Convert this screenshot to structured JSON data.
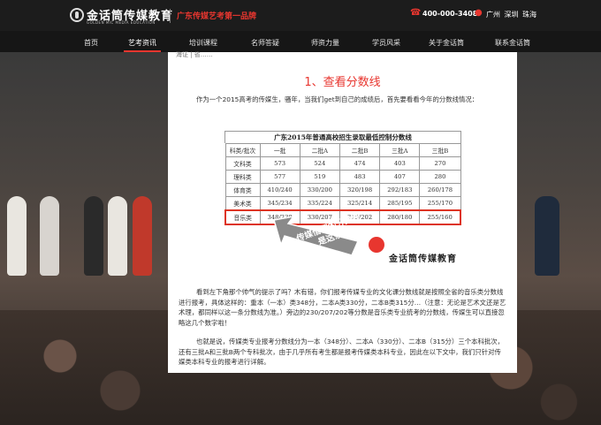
{
  "header": {
    "logo_text": "金话筒传媒教育",
    "logo_sub": "GOLDEN MIC MEDIA EDUCATION",
    "slogan": "广东传媒艺考第一品牌",
    "phone": "400-000-3408",
    "cities": "广州  深圳  珠海"
  },
  "nav": [
    "首页",
    "艺考资讯",
    "培训课程",
    "名师答疑",
    "师资力量",
    "学员风采",
    "关于金话筒",
    "联系金话筒"
  ],
  "crumb": "海证 | 省……",
  "article": {
    "title": "1、查看分数线",
    "para1": "作为一个2015高考的传媒生，骚年，当我们get到自己的成绩后，首先要看看今年的分数线情况：",
    "table": {
      "title": "广东2015年普通高校招生录取最低控制分数线",
      "headers": [
        "科类/批次",
        "一批",
        "二批A",
        "二批B",
        "三批A",
        "三批B"
      ],
      "rows": [
        [
          "文科类",
          "573",
          "524",
          "474",
          "403",
          "270"
        ],
        [
          "理科类",
          "577",
          "519",
          "483",
          "407",
          "280"
        ],
        [
          "体育类",
          "410/240",
          "330/200",
          "320/198",
          "292/183",
          "260/178"
        ],
        [
          "美术类",
          "345/234",
          "335/224",
          "325/214",
          "285/195",
          "255/170"
        ],
        [
          "音乐类",
          "348/230",
          "330/207",
          "315/202",
          "280/180",
          "255/160"
        ]
      ]
    },
    "callout": "传媒借们的分数线是这条!",
    "watermark": "金话筒传媒教育",
    "para2": "看到左下角那个帅气的提示了吗？木有错，你们报考传媒专业的文化课分数线就是按照全省的音乐类分数线进行报考，具体这样的：重本（一本）类348分，二本A类330分，二本B类315分…（注意：无论是艺术文还是艺术理，都同样以这一条分数线为准。）旁边的230/207/202等分数是音乐类专业统考的分数线，传媒生可以直接忽略这几个数字啦！",
    "para3": "也就是说，传媒类专业报考分数线分为一本（348分）、二本A（330分）、二本B（315分）三个本科批次，还有三批A和三批B两个专科批次，由于几乎所有考生都是报考传媒类本科专业，因此在以下文中，我们只针对传媒类本科专业的报考进行详解。"
  },
  "colors": {
    "accent": "#e8362f",
    "topbar": "#1c1c1c"
  }
}
